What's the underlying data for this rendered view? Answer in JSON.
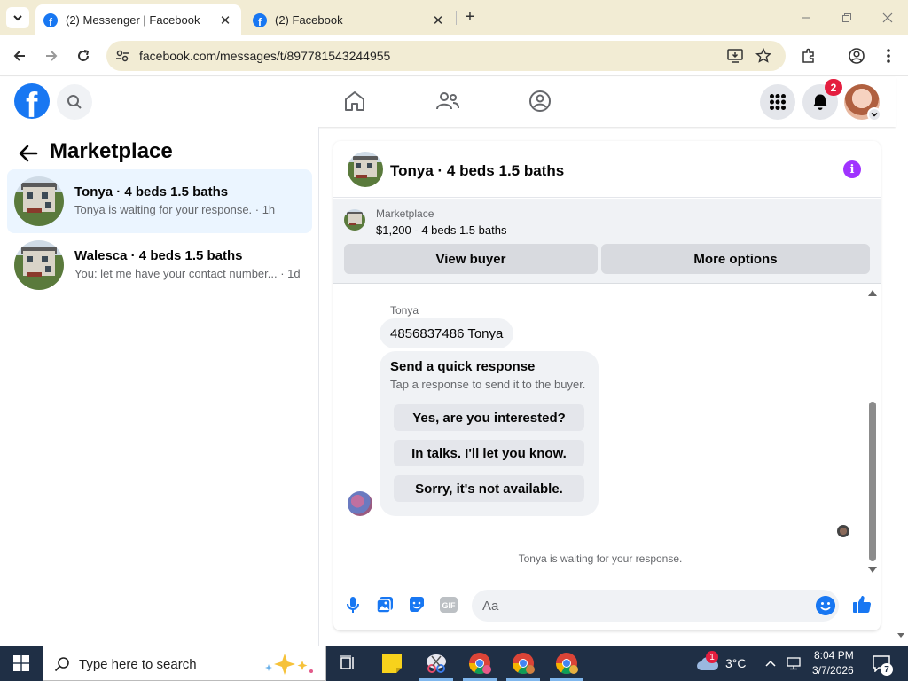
{
  "browser": {
    "tabs": [
      {
        "title": "(2) Messenger | Facebook",
        "active": true
      },
      {
        "title": "(2) Facebook",
        "active": false
      }
    ],
    "url": "facebook.com/messages/t/897781543244955"
  },
  "fb": {
    "notification_count": "2"
  },
  "left": {
    "title": "Marketplace",
    "conversations": [
      {
        "title": "Tonya · 4 beds 1.5 baths",
        "subtitle": "Tonya is waiting for your response. · 1h",
        "selected": true
      },
      {
        "title": "Walesca · 4 beds 1.5 baths",
        "subtitle": "You: let me have your contact number... · 1d",
        "selected": false
      }
    ]
  },
  "chat": {
    "title": "Tonya · 4 beds 1.5 baths",
    "marketplace_label": "Marketplace",
    "listing": "$1,200 - 4 beds 1.5 baths",
    "view_buyer": "View buyer",
    "more_options": "More options",
    "sender": "Tonya",
    "message": "4856837486 Tonya",
    "quick_title": "Send a quick response",
    "quick_sub": "Tap a response to send it to the buyer.",
    "quick_replies": [
      "Yes, are you interested?",
      "In talks. I'll let you know.",
      "Sorry, it's not available."
    ],
    "status": "Tonya is waiting for your response.",
    "composer_placeholder": "Aa"
  },
  "taskbar": {
    "search_placeholder": "Type here to search",
    "weather_badge": "1",
    "temperature": "3°C",
    "time": "8:04 PM",
    "date": "3/7/2026",
    "notification_count": "7"
  },
  "colors": {
    "fb_blue": "#1877f2",
    "tab_strip": "#f2ecd4",
    "selected_conv": "#ebf5ff",
    "taskbar": "#1f2f45",
    "info_purple": "#a033ff"
  }
}
